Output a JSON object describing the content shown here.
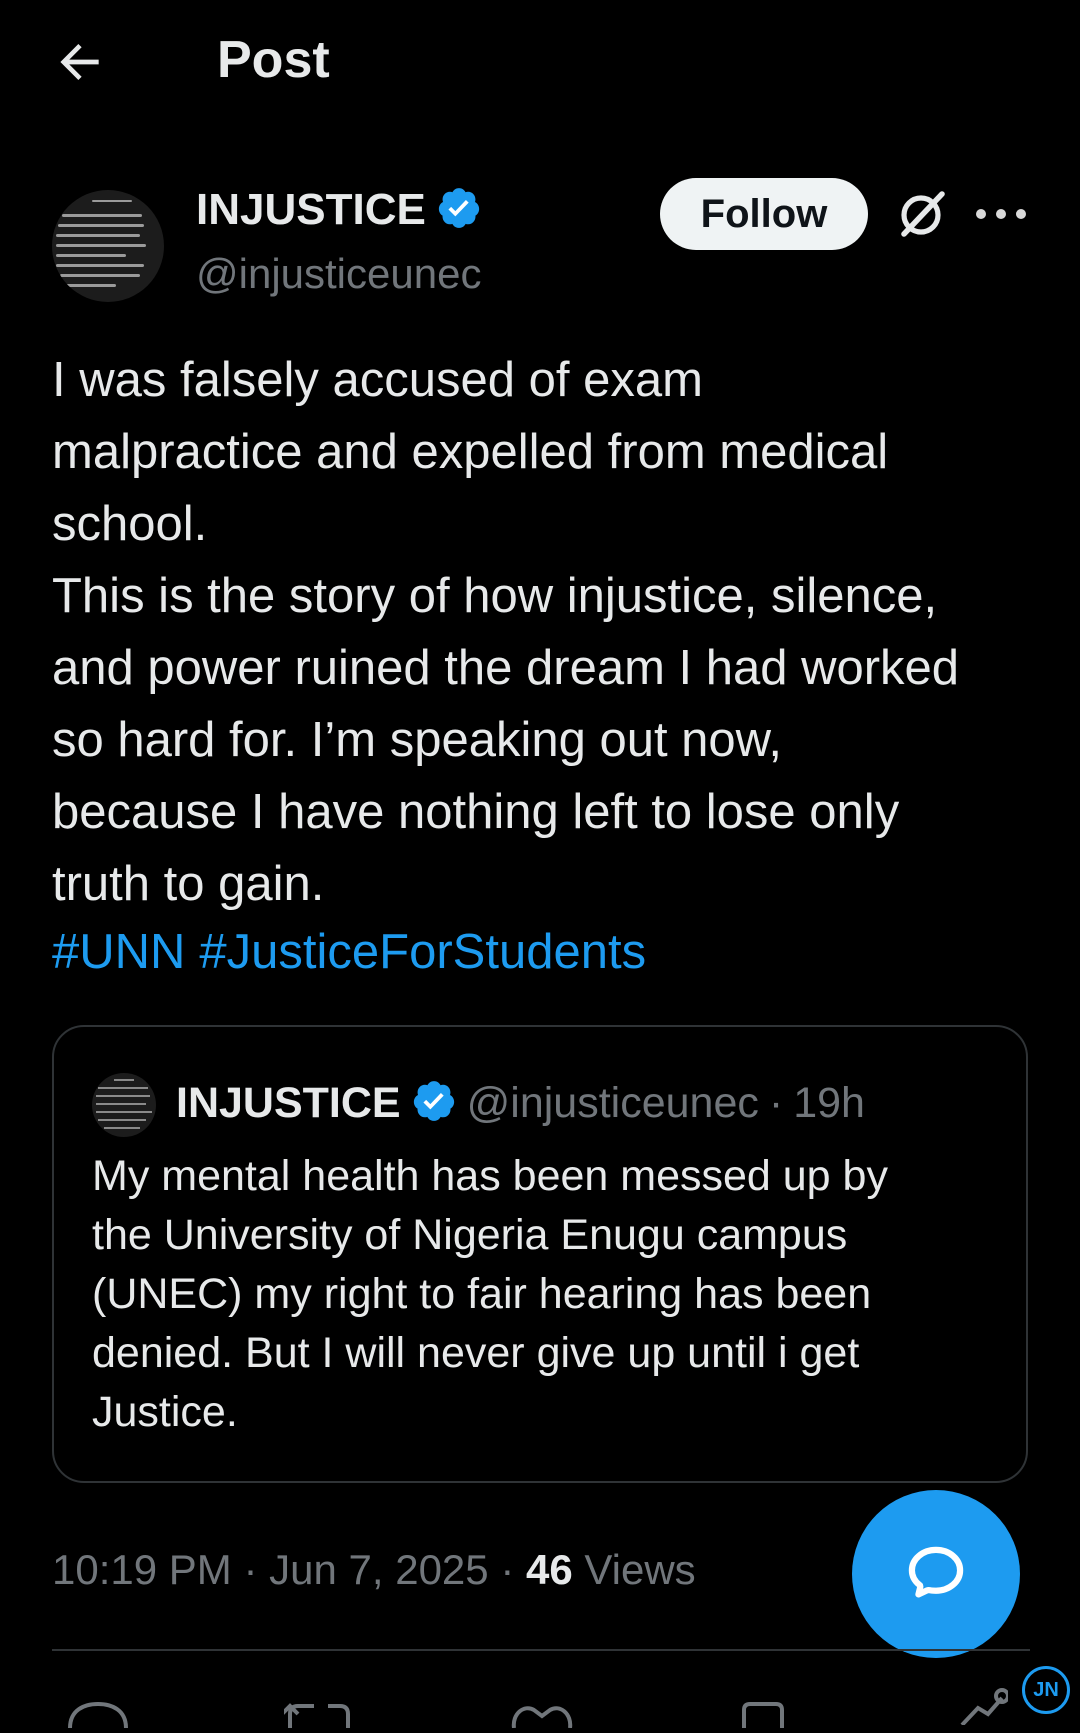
{
  "header": {
    "title": "Post"
  },
  "author": {
    "name": "INJUSTICE",
    "handle": "@injusticeunec",
    "follow_label": "Follow"
  },
  "post": {
    "lines": [
      "I was falsely accused of exam",
      "malpractice and expelled from medical",
      "school.",
      "This is the story of how injustice, silence,",
      "and power ruined the dream I had worked",
      "so hard for. I’m speaking out now,",
      "because I have nothing left to lose only",
      "truth to gain."
    ],
    "hashtags": [
      "#UNN",
      "#JusticeForStudents"
    ]
  },
  "quote": {
    "name": "INJUSTICE",
    "handle": "@injusticeunec",
    "separator": "·",
    "time": "19h",
    "lines": [
      "My mental health has been messed up by",
      "the University of Nigeria Enugu campus",
      "(UNEC) my right to fair hearing has been",
      "denied. But I will never give up until i get",
      "Justice."
    ]
  },
  "meta": {
    "time": "10:19 PM",
    "sep": "·",
    "date": "Jun 7, 2025",
    "views_count": "46",
    "views_label": "Views"
  },
  "watermark": "JN",
  "colors": {
    "accent": "#1d9bf0",
    "background": "#000000",
    "muted": "#71767b"
  }
}
